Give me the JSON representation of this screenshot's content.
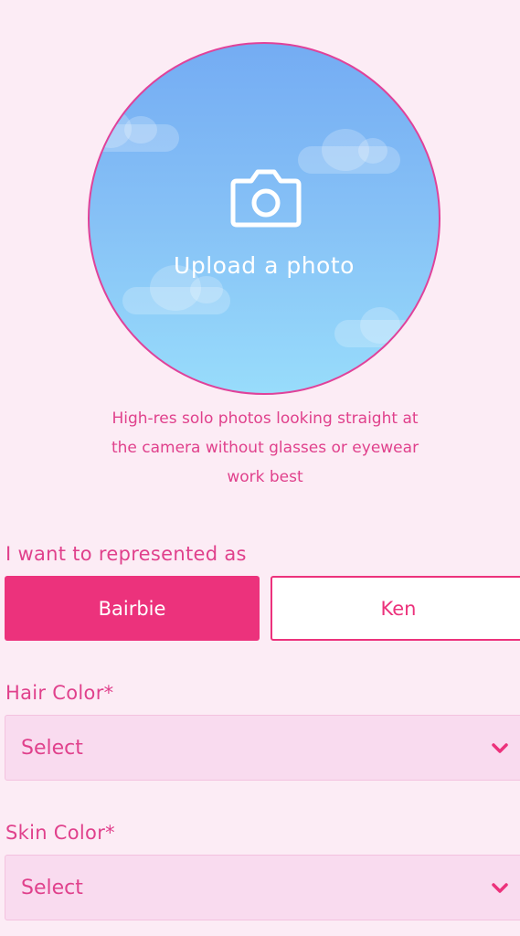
{
  "upload": {
    "label": "Upload a photo",
    "icon": "camera-icon",
    "hint": "High-res solo photos looking straight at the camera without glasses or eyewear work best"
  },
  "represent": {
    "label": "I want to represented as",
    "options": [
      "Bairbie",
      "Ken"
    ],
    "selected": "Bairbie"
  },
  "hair": {
    "label": "Hair Color*",
    "value": "Select"
  },
  "skin": {
    "label": "Skin Color*",
    "value": "Select"
  },
  "colors": {
    "background": "#fcecf5",
    "accent": "#ec327c",
    "text_pink": "#e0418c",
    "select_bg": "#f9dbef",
    "sky_top": "#74acf3",
    "sky_bottom": "#98dcfb"
  }
}
